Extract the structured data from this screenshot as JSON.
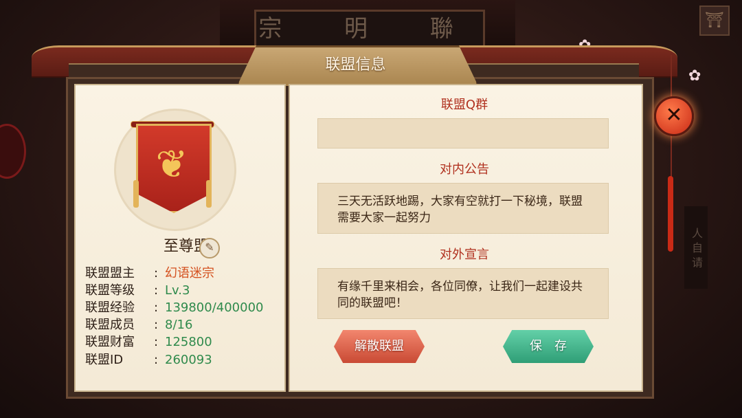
{
  "background": {
    "sign_text": "宗 明 聯",
    "right_scroll_text": "人 自 请"
  },
  "dialog": {
    "title": "联盟信息"
  },
  "alliance": {
    "name": "至尊盟",
    "fields": [
      {
        "label": "联盟盟主",
        "value": "幻语迷宗",
        "style": "red"
      },
      {
        "label": "联盟等级",
        "value": "Lv.3",
        "style": "green"
      },
      {
        "label": "联盟经验",
        "value": "139800/400000",
        "style": "green"
      },
      {
        "label": "联盟成员",
        "value": "8/16",
        "style": "green"
      },
      {
        "label": "联盟财富",
        "value": "125800",
        "style": "green"
      },
      {
        "label": "联盟ID",
        "value": "260093",
        "style": "green"
      }
    ]
  },
  "sections": {
    "qq_group_title": "联盟Q群",
    "qq_group_value": "",
    "internal_notice_title": "对内公告",
    "internal_notice_text": "三天无活跃地踢，大家有空就打一下秘境，联盟需要大家一起努力",
    "external_declaration_title": "对外宣言",
    "external_declaration_text": "有缘千里来相会，各位同僚，让我们一起建设共同的联盟吧！"
  },
  "buttons": {
    "disband": "解散联盟",
    "save": "保存",
    "close": "✕"
  },
  "icons": {
    "edit": "edit-brush-icon",
    "emblem": "dragon-banner-icon"
  },
  "colors": {
    "accent_red": "#b0301e",
    "value_red": "#d4501e",
    "value_green": "#2f8a4c",
    "panel_bg": "#faf3e4",
    "textbox_bg": "#ecdcc0"
  }
}
